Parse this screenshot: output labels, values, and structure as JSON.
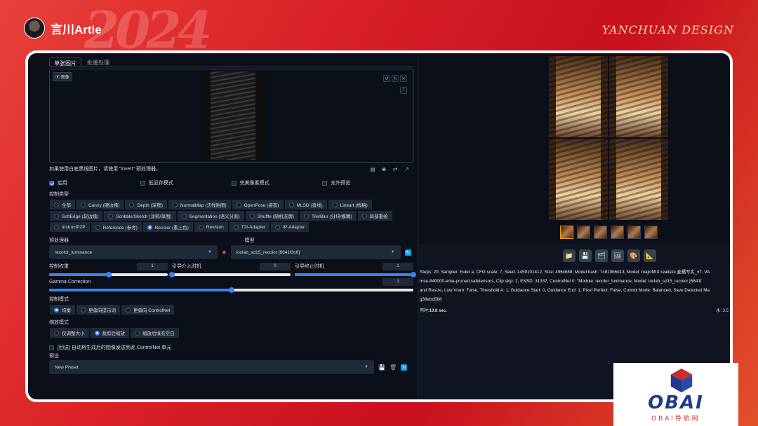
{
  "brand": {
    "name": "言川Artie",
    "signature": "YANCHUAN DESIGN"
  },
  "tabs": [
    {
      "label": "单张图片",
      "active": true
    },
    {
      "label": "批量处理",
      "active": false
    }
  ],
  "image": {
    "tag": "图像"
  },
  "hint": "如果使用白底黑线图片，请使用 \"invert\" 预处理器。",
  "checks": [
    {
      "label": "启用",
      "on": true
    },
    {
      "label": "低显存模式",
      "on": false
    },
    {
      "label": "完美像素模式",
      "on": false
    },
    {
      "label": "允许预览",
      "on": false
    }
  ],
  "control_type": {
    "label": "控制类型",
    "options": [
      "全部",
      "Canny (硬边缘)",
      "Depth (深度)",
      "NormalMap (法线贴图)",
      "OpenPose (姿态)",
      "MLSD (直线)",
      "Lineart (线稿)",
      "SoftEdge (软边缘)",
      "Scribble/Sketch (涂鸦/草图)",
      "Segmentation (语义分割)",
      "Shuffle (随机洗牌)",
      "Tile/Blur (分块/模糊)",
      "局部重绘",
      "InstructP2P",
      "Reference (参考)",
      "Recolor (重上色)",
      "Revision",
      "T2I-Adapter",
      "IP-Adapter"
    ],
    "selected": "Recolor (重上色)"
  },
  "preprocessor": {
    "label": "预处理器",
    "value": "recolor_luminance"
  },
  "model": {
    "label": "模型",
    "value": "ioclab_sd15_recolor [6641f3c6]"
  },
  "sliders": [
    {
      "label": "控制权重",
      "value": "1",
      "pct": 0.5
    },
    {
      "label": "引导介入时机",
      "value": "0",
      "pct": 0.0
    },
    {
      "label": "引导终止时机",
      "value": "1",
      "pct": 1.0
    }
  ],
  "gamma": {
    "label": "Gamma Correction",
    "value": "1",
    "pct": 0.5
  },
  "control_mode": {
    "label": "控制模式",
    "options": [
      "均衡",
      "更偏向提示词",
      "更偏向 ControlNet"
    ],
    "selected": "均衡"
  },
  "resize_mode": {
    "label": "缩放模式",
    "options": [
      "仅调整大小",
      "裁剪后缩放",
      "缩放后填充空白"
    ],
    "selected": "裁剪后缩放"
  },
  "loopback": {
    "label": "[回送] 自动将生成后的图像发送到此 ControlNet 单元"
  },
  "preset": {
    "label": "预设",
    "value": "New Preset"
  },
  "gen_info": [
    "Steps: 20, Sampler: Euler a, CFG scale: 7, Seed: 1459101412, Size: 496x688, Model hash: 7c819b6d13, Model: majicMIX realistic 麦橘写实_v7, VA",
    "mse-840000-ema-pruned.safetensors, Clip skip: 2, ENSD: 31337, ControlNet 0: \"Module: recolor_luminance, Model: ioclab_sd15_recolor [6641f",
    "and Resize, Low Vram: False, Threshold A: 1, Guidance Start: 0, Guidance End: 1, Pixel Perfect: False, Control Mode: Balanced, Save Detected Ma",
    "g39ebd568"
  ],
  "time": {
    "label": "用时:",
    "value": "10.8 sec."
  },
  "vram": "永: 3.5",
  "logo": {
    "text": "OBAI",
    "sub": "OBAI导航网"
  },
  "colors": {
    "accent": "#3b82f6",
    "bg": "#0b0f19",
    "brand_red": "#d92027"
  }
}
